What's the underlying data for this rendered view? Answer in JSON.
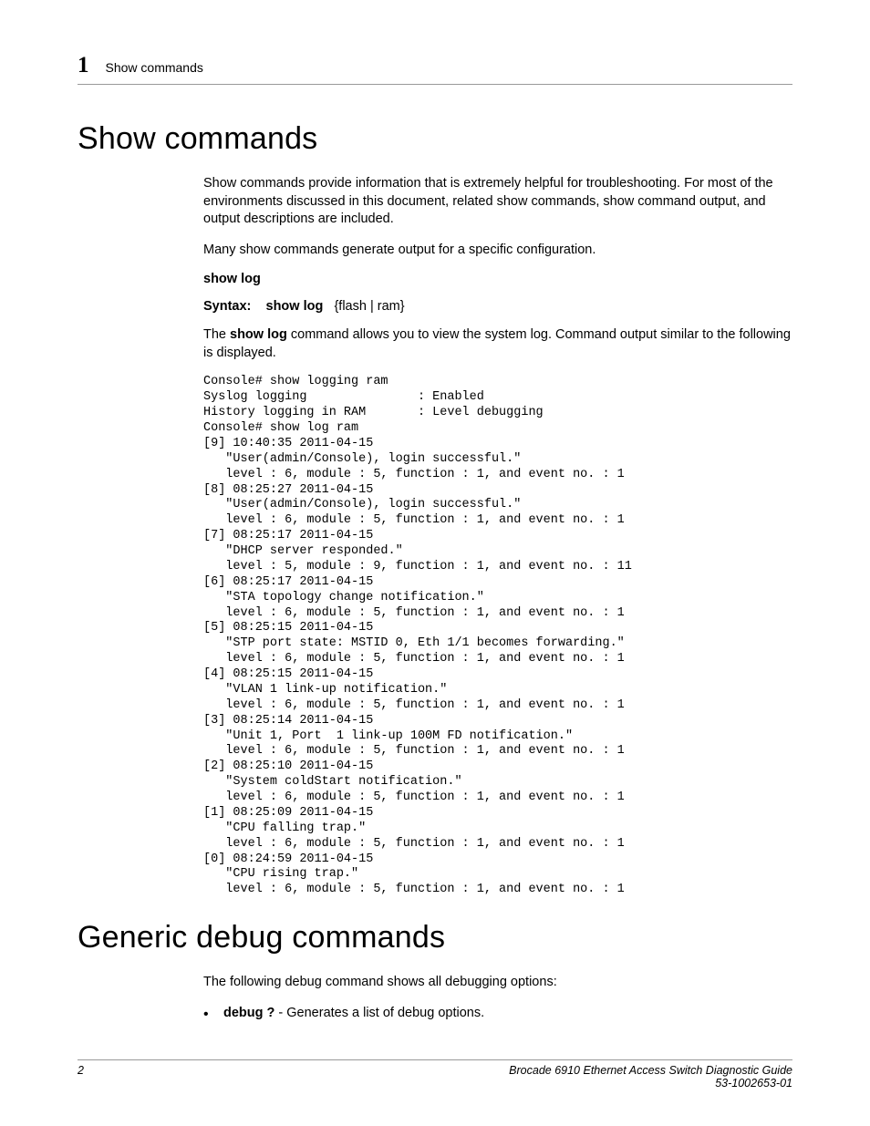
{
  "header": {
    "chapter_num": "1",
    "section_name": "Show commands"
  },
  "section1": {
    "title": "Show commands",
    "para1": "Show commands provide information that is extremely helpful for troubleshooting. For most of the environments discussed in this document, related show commands, show command output, and output descriptions are included.",
    "para2": "Many show commands generate output for a specific configuration.",
    "subhead": "show log",
    "syntax_label": "Syntax:",
    "syntax_cmd": "show log",
    "syntax_args": "{flash | ram}",
    "para3_pre": "The ",
    "para3_bold": "show log",
    "para3_post": " command allows you to view the system log. Command output similar to the following is displayed.",
    "console": "Console# show logging ram\nSyslog logging               : Enabled\nHistory logging in RAM       : Level debugging\nConsole# show log ram\n[9] 10:40:35 2011-04-15\n   \"User(admin/Console), login successful.\"\n   level : 6, module : 5, function : 1, and event no. : 1\n[8] 08:25:27 2011-04-15\n   \"User(admin/Console), login successful.\"\n   level : 6, module : 5, function : 1, and event no. : 1\n[7] 08:25:17 2011-04-15\n   \"DHCP server responded.\"\n   level : 5, module : 9, function : 1, and event no. : 11\n[6] 08:25:17 2011-04-15\n   \"STA topology change notification.\"\n   level : 6, module : 5, function : 1, and event no. : 1\n[5] 08:25:15 2011-04-15\n   \"STP port state: MSTID 0, Eth 1/1 becomes forwarding.\"\n   level : 6, module : 5, function : 1, and event no. : 1\n[4] 08:25:15 2011-04-15\n   \"VLAN 1 link-up notification.\"\n   level : 6, module : 5, function : 1, and event no. : 1\n[3] 08:25:14 2011-04-15\n   \"Unit 1, Port  1 link-up 100M FD notification.\"\n   level : 6, module : 5, function : 1, and event no. : 1\n[2] 08:25:10 2011-04-15\n   \"System coldStart notification.\"\n   level : 6, module : 5, function : 1, and event no. : 1\n[1] 08:25:09 2011-04-15\n   \"CPU falling trap.\"\n   level : 6, module : 5, function : 1, and event no. : 1\n[0] 08:24:59 2011-04-15\n   \"CPU rising trap.\"\n   level : 6, module : 5, function : 1, and event no. : 1"
  },
  "section2": {
    "title": "Generic debug commands",
    "para1": "The following debug command shows all debugging options:",
    "bullet1_bold": "debug ?",
    "bullet1_rest": " - Generates a list of debug options."
  },
  "footer": {
    "page_number": "2",
    "doc_title": "Brocade 6910 Ethernet Access Switch Diagnostic Guide",
    "doc_number": "53-1002653-01"
  }
}
